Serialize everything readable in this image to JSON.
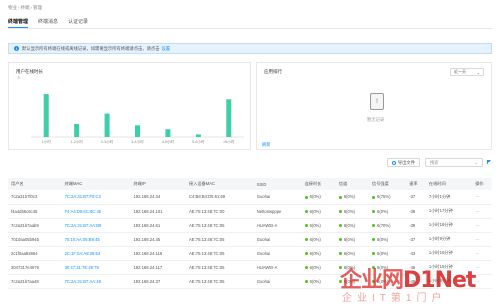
{
  "breadcrumb": [
    "物业",
    "终端",
    "管理"
  ],
  "tabs": [
    {
      "label": "终端管理",
      "active": true
    },
    {
      "label": "终端消息",
      "active": false
    },
    {
      "label": "认证记录",
      "active": false
    }
  ],
  "notice": {
    "text": "默认显示所有终端在线或离线记录，如需要显示所有终端请点击，请点击",
    "link": "设置"
  },
  "chart_card": {
    "title": "用户在线时长",
    "ylabel": "人"
  },
  "chart_data": {
    "type": "bar",
    "categories": [
      "1小时",
      "1-2小时",
      "2-3小时",
      "3-4小时",
      "4-5小时",
      "5-6小时",
      ">6小时"
    ],
    "values": [
      33,
      10,
      18,
      9,
      6,
      2,
      29
    ],
    "ylim": [
      0,
      40
    ],
    "color": "#3ecfa8",
    "grid": false
  },
  "app_card": {
    "title": "应用排行",
    "select": "近一天",
    "empty_text": "暂无记录",
    "refresh": "刷新"
  },
  "toolbar": {
    "export_label": "导出文件",
    "search_placeholder": "搜索"
  },
  "table": {
    "columns": [
      "用户名",
      "终端MAC",
      "终端IP",
      "接入设备MAC",
      "SSID",
      "连接时长",
      "信道",
      "信号强度",
      "速率",
      "在线时间",
      "操作"
    ],
    "rows": [
      {
        "user": "7c2a31b7f0c3",
        "mac": "7C:2A:31:B7:F0:C3",
        "ip": "192.168.24.34",
        "ap": "C4:B8:B4:D5:61:69",
        "ssid": "Guohai",
        "dur": "6(0%)",
        "ch": "6(0%)",
        "sig": "6(75%)",
        "rate": "-37",
        "time": "7小时1分钟"
      },
      {
        "user": "f4a4d56c6c45",
        "mac": "F4:A4:D5:6C:6C:45",
        "ip": "192.168.24.101",
        "ap": "AE:75:13:48:7C:00",
        "ssid": "Nettonwpppe",
        "dur": "6(0%)",
        "ch": "6(0%)",
        "sig": "6(0%)",
        "rate": "-39",
        "time": "1小时17分钟"
      },
      {
        "user": "7c2a31b7aab9",
        "mac": "7C:2A:31:B7:AA:B9",
        "ip": "192.168.24.61",
        "ap": "AE:75:13:48:7C:05",
        "ssid": "HUAWEI-A",
        "dur": "6(0%)",
        "ch": "6(0%)",
        "sig": "6(70%)",
        "rate": "-39",
        "time": "1小时16分钟"
      },
      {
        "user": "7010aa05b945",
        "mac": "70:10:AA:05:B9:45",
        "ip": "192.168.24.45",
        "ap": "AE:75:13:48:7C:05",
        "ssid": "Guohai",
        "dur": "6(0%)",
        "ch": "6(0%)",
        "sig": "6(0%)",
        "rate": "-37",
        "time": "1小时9分钟"
      },
      {
        "user": "2c1f0aa82864",
        "mac": "2C:1F:0A:A8:28:64",
        "ip": "192.168.24.116",
        "ap": "AE:75:13:48:7C:05",
        "ssid": "Guohai",
        "dur": "6(0%)",
        "ch": "6(0%)",
        "sig": "6(0%)",
        "rate": "-43",
        "time": "1小时16分钟"
      },
      {
        "user": "3047317e4979",
        "mac": "30:47:31:7E:49:79",
        "ip": "192.168.24.117",
        "ap": "AE:75:13:48:7C:05",
        "ssid": "HUAWEI-A",
        "dur": "6(0%)",
        "ch": "6(0%)",
        "sig": "6(0%)",
        "rate": "-46",
        "time": "1小时15分钟"
      },
      {
        "user": "7c2a31b7aa48",
        "mac": "7C:2A:31:B7:AA:48",
        "ip": "192.168.24.37",
        "ap": "AE:75:13:48:7C:05",
        "ssid": "Guohai",
        "dur": "6(0%)",
        "ch": "6(0%)",
        "sig": "6(0%)",
        "rate": "-49",
        "time": "1小时9分钟"
      }
    ]
  },
  "watermark": {
    "top": "企业网D1Net",
    "bottom": "企业IT第1门户"
  }
}
